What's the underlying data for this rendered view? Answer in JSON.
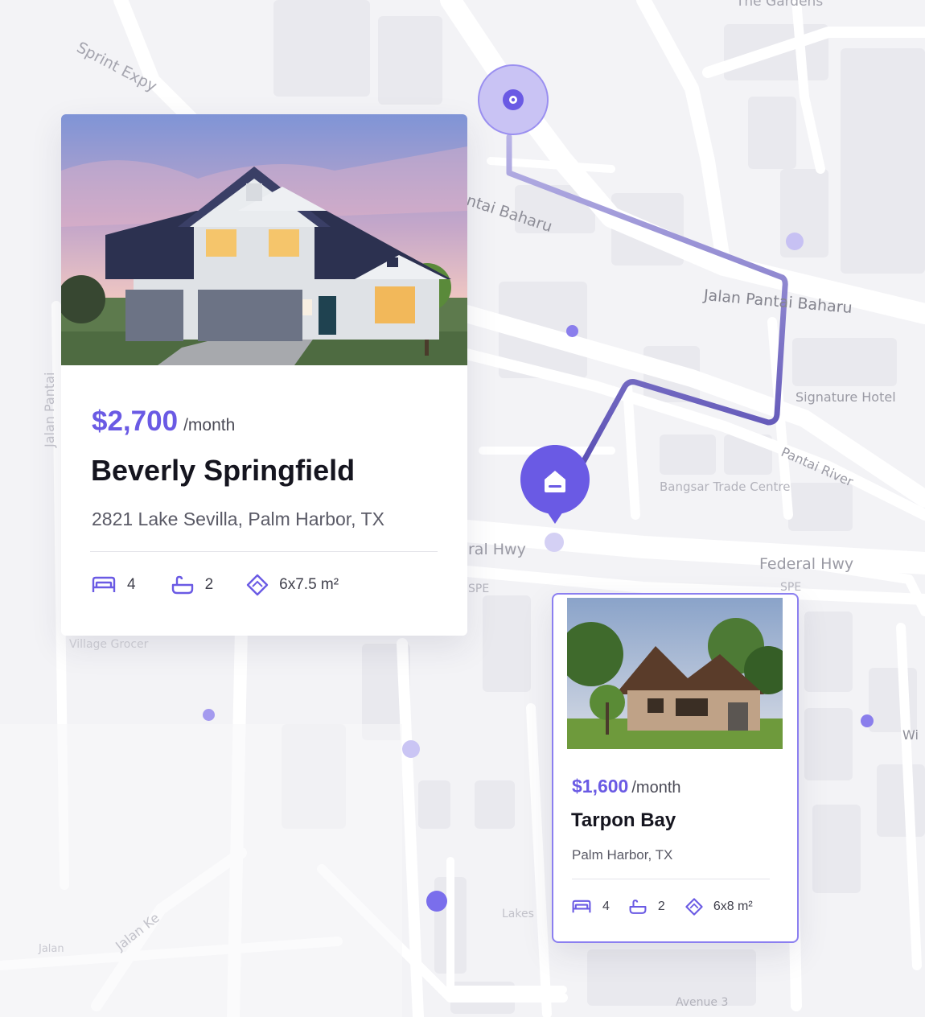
{
  "colors": {
    "accent": "#6a5ae4",
    "route": "#6d61c2",
    "background": "#f3f3f6",
    "road": "#ffffff",
    "block": "#e9e9ee"
  },
  "map": {
    "labels": {
      "sprint_expy": "Sprint Expy",
      "pantai_baharu_partial": "ntai Baharu",
      "jalan_pantai_baharu": "Jalan Pantai Baharu",
      "signature_hotel": "Signature Hotel",
      "pantai_river": "Pantai River",
      "bangsar_trade_centre": "Bangsar Trade Centre",
      "federal_hwy": "Federal Hwy",
      "federal_hwy_partial": "ral Hwy",
      "spe_left": "SPE",
      "spe_right": "SPE",
      "jalan_pantai_vertical": "Jalan Pantai",
      "village_grocer": "Village Grocer",
      "jalan_ke": "Jalan Ke",
      "lakeside": "Lakes",
      "avenue_3": "Avenue 3",
      "wi": "Wi",
      "top_partial": "The Gardens",
      "jalan_bottom": "Jalan"
    },
    "origin_icon": "location-target-icon",
    "destination_icon": "home-pin-icon"
  },
  "listings": [
    {
      "price": "$2,700",
      "unit": "/month",
      "name": "Beverly Springfield",
      "address": "2821 Lake Sevilla, Palm Harbor, TX",
      "beds": "4",
      "baths": "2",
      "area": "6x7.5 m²",
      "bed_icon": "bed-icon",
      "bath_icon": "bathtub-icon",
      "area_icon": "area-icon",
      "photo": "modern-house-photo"
    },
    {
      "price": "$1,600",
      "unit": "/month",
      "name": "Tarpon Bay",
      "address": "Palm Harbor, TX",
      "beds": "4",
      "baths": "2",
      "area": "6x8 m²",
      "bed_icon": "bed-icon",
      "bath_icon": "bathtub-icon",
      "area_icon": "area-icon",
      "photo": "stone-house-photo"
    }
  ]
}
